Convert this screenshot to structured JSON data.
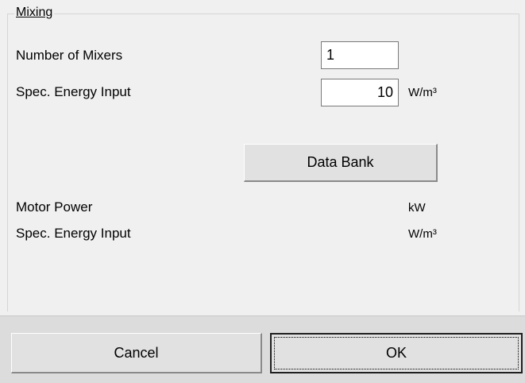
{
  "group": {
    "title": "Mixing"
  },
  "inputs": {
    "number_of_mixers": {
      "label": "Number of Mixers",
      "value": "1"
    },
    "spec_energy_input": {
      "label": "Spec. Energy Input",
      "value": "10",
      "unit": "W/m³"
    }
  },
  "data_bank_button": "Data Bank",
  "results": {
    "motor_power": {
      "label": "Motor Power",
      "unit": "kW"
    },
    "spec_energy_input": {
      "label": "Spec. Energy Input",
      "unit": "W/m³"
    }
  },
  "footer": {
    "cancel_label": "Cancel",
    "ok_label": "OK"
  }
}
